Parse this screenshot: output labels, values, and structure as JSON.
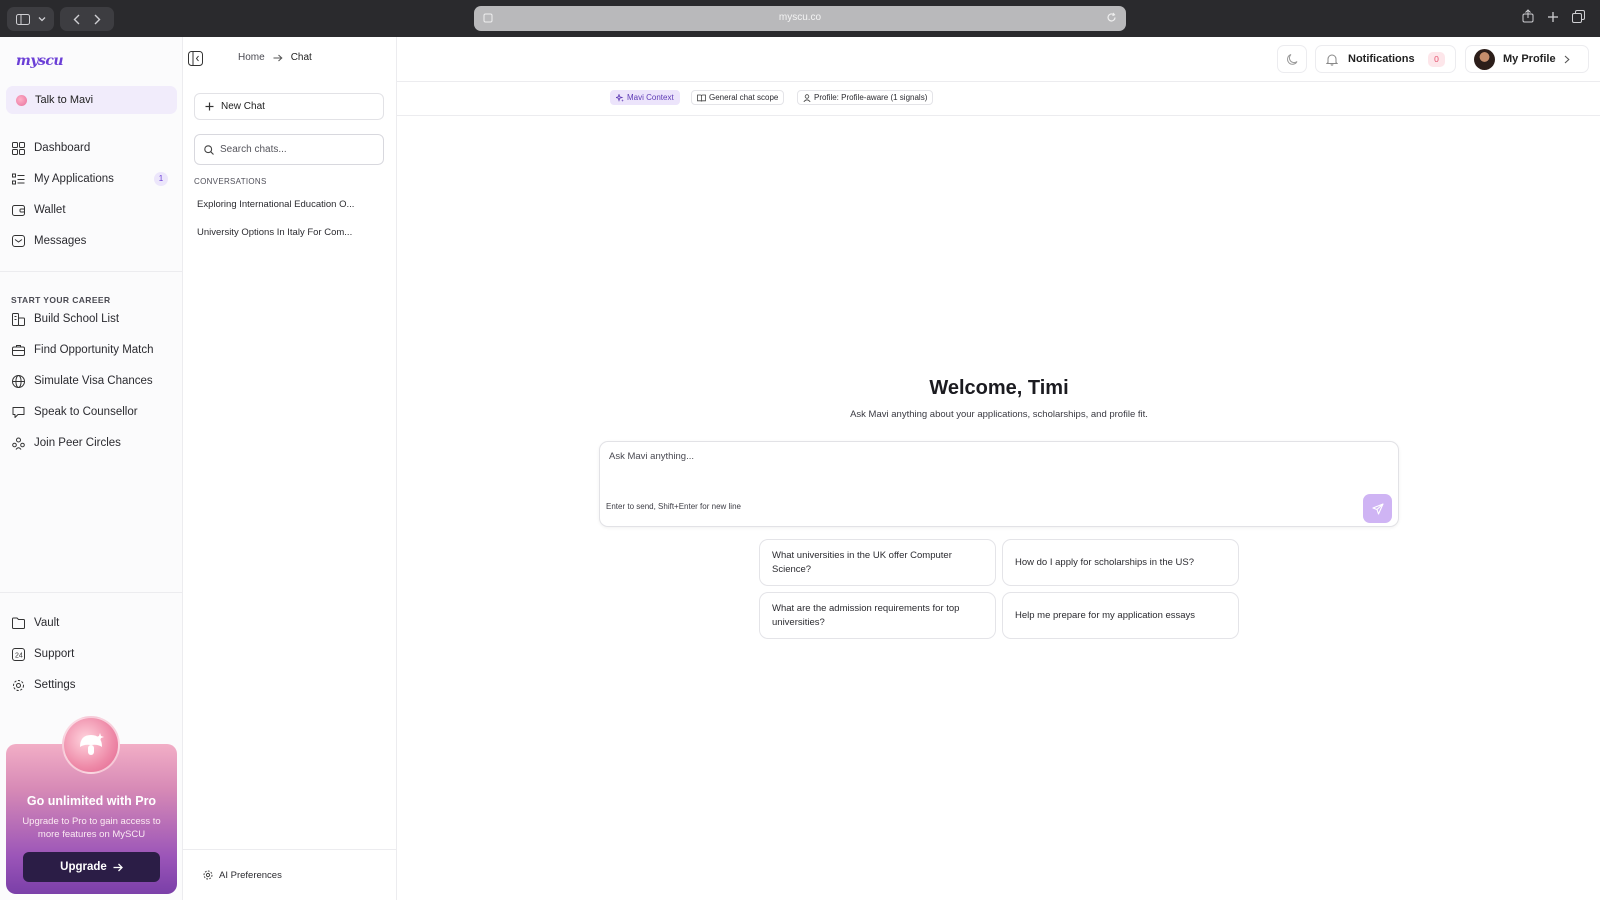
{
  "browser": {
    "url": "myscu.co"
  },
  "sidebar": {
    "logo": "myscu",
    "talk_label": "Talk to Mavi",
    "items": [
      {
        "label": "Dashboard",
        "icon": "grid-icon"
      },
      {
        "label": "My Applications",
        "icon": "list-icon",
        "badge": "1"
      },
      {
        "label": "Wallet",
        "icon": "wallet-icon"
      },
      {
        "label": "Messages",
        "icon": "mail-icon"
      }
    ],
    "section_title": "START YOUR CAREER",
    "career_items": [
      {
        "label": "Build School List",
        "icon": "school-list-icon"
      },
      {
        "label": "Find Opportunity Match",
        "icon": "briefcase-icon"
      },
      {
        "label": "Simulate Visa Chances",
        "icon": "globe-icon"
      },
      {
        "label": "Speak to Counsellor",
        "icon": "chat-bubble-icon"
      },
      {
        "label": "Join Peer Circles",
        "icon": "people-icon"
      }
    ],
    "bottom_items": [
      {
        "label": "Vault",
        "icon": "folder-icon"
      },
      {
        "label": "Support",
        "icon": "support-icon"
      },
      {
        "label": "Settings",
        "icon": "gear-icon"
      }
    ],
    "promo": {
      "title": "Go unlimited with Pro",
      "text": "Upgrade to Pro to gain access to more features on MySCU",
      "button": "Upgrade"
    }
  },
  "chat_panel": {
    "new_chat": "New Chat",
    "search_placeholder": "Search chats...",
    "conversations_title": "CONVERSATIONS",
    "conversations": [
      "Exploring International Education O...",
      "University Options In Italy For Com..."
    ],
    "ai_preferences": "AI Preferences"
  },
  "header": {
    "breadcrumb": [
      "Home",
      "Chat"
    ],
    "notifications_label": "Notifications",
    "notifications_count": "0",
    "profile_label": "My Profile"
  },
  "context_chips": [
    {
      "label": "Mavi Context",
      "icon": "sparkle-icon"
    },
    {
      "label": "General chat scope",
      "icon": "book-icon"
    },
    {
      "label": "Profile: Profile-aware (1 signals)",
      "icon": "user-icon"
    }
  ],
  "main": {
    "welcome_title": "Welcome, Timi",
    "welcome_sub": "Ask Mavi anything about your applications, scholarships, and profile fit.",
    "input_placeholder": "Ask Mavi anything...",
    "input_hint": "Enter to send, Shift+Enter for new line",
    "suggestions": [
      "What universities in the UK offer Computer Science?",
      "How do I apply for scholarships in the US?",
      "What are the admission requirements for top universities?",
      "Help me prepare for my application essays"
    ]
  },
  "colors": {
    "accent": "#6b3fd6",
    "send_button": "#cfb4f4",
    "promo_dark": "#2b1d46"
  }
}
